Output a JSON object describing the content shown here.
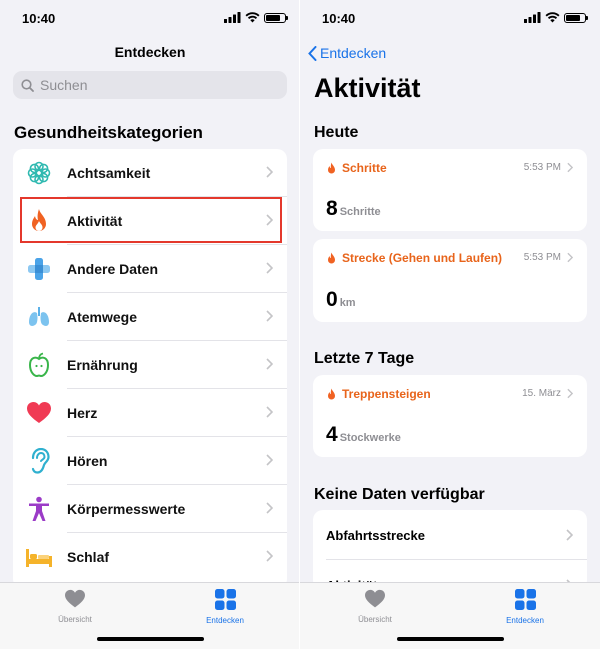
{
  "left": {
    "status": {
      "time": "10:40",
      "battery_level": 0.8
    },
    "title": "Entdecken",
    "search": {
      "placeholder": "Suchen",
      "value": ""
    },
    "section_title": "Gesundheitskategorien",
    "categories": [
      {
        "label": "Achtsamkeit",
        "icon": "mindfulness-flower-icon",
        "color": "#2fb9b0"
      },
      {
        "label": "Aktivität",
        "icon": "flame-icon",
        "color": "#f06222"
      },
      {
        "label": "Andere Daten",
        "icon": "plus-cross-icon",
        "color": "#4aa3e8"
      },
      {
        "label": "Atemwege",
        "icon": "lungs-icon",
        "color": "#5ab0e8"
      },
      {
        "label": "Ernährung",
        "icon": "apple-icon",
        "color": "#39b54a"
      },
      {
        "label": "Herz",
        "icon": "heart-icon",
        "color": "#f03a54"
      },
      {
        "label": "Hören",
        "icon": "ear-icon",
        "color": "#2fb0cf"
      },
      {
        "label": "Körpermesswerte",
        "icon": "body-figure-icon",
        "color": "#9b3bc7"
      },
      {
        "label": "Schlaf",
        "icon": "bed-icon",
        "color": "#f5b32a"
      }
    ],
    "tabs": [
      {
        "label": "Übersicht",
        "icon": "heart-icon",
        "active": false
      },
      {
        "label": "Entdecken",
        "icon": "grid-icon",
        "active": true
      }
    ]
  },
  "right": {
    "status": {
      "time": "10:40",
      "battery_level": 0.8
    },
    "back_label": "Entdecken",
    "title": "Aktivität",
    "today": {
      "heading": "Heute",
      "cards": [
        {
          "title": "Schritte",
          "time": "5:53 PM",
          "value": "8",
          "unit": "Schritte"
        },
        {
          "title": "Strecke (Gehen und Laufen)",
          "time": "5:53 PM",
          "value": "0",
          "unit": "km"
        }
      ]
    },
    "last7": {
      "heading": "Letzte 7 Tage",
      "cards": [
        {
          "title": "Treppensteigen",
          "time": "15. März",
          "value": "4",
          "unit": "Stockwerke"
        }
      ]
    },
    "no_data": {
      "heading": "Keine Daten verfügbar",
      "items": [
        "Abfahrtsstrecke",
        "Aktivität"
      ]
    },
    "tabs": [
      {
        "label": "Übersicht",
        "icon": "heart-icon",
        "active": false
      },
      {
        "label": "Entdecken",
        "icon": "grid-icon",
        "active": true
      }
    ]
  },
  "colors": {
    "accent": "#1a73e8",
    "activity_orange": "#e8641b",
    "highlight_box": "#e4382c",
    "tab_inactive": "#8e8e93"
  }
}
